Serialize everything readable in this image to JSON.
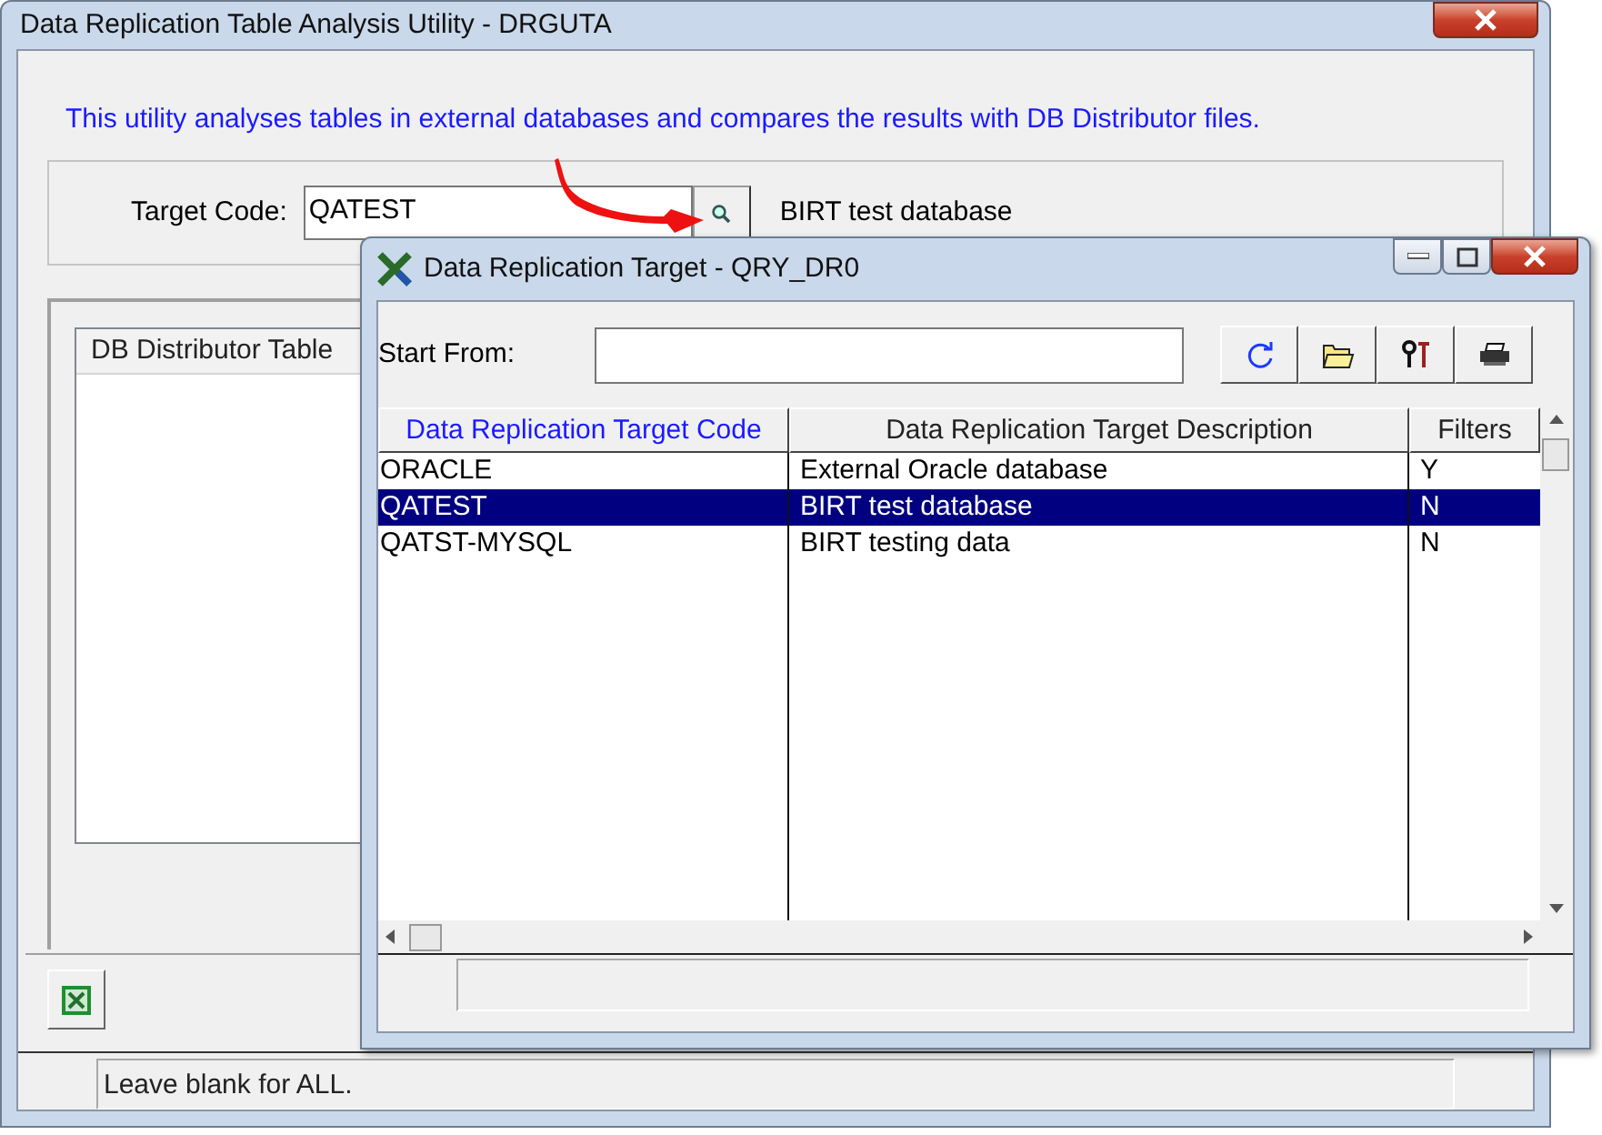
{
  "main_window": {
    "title": "Data Replication Table Analysis Utility - DRGUTA",
    "intro": "This utility analyses tables in external databases and compares the results with DB Distributor files.",
    "target_code": {
      "label": "Target Code:",
      "value": "QATEST",
      "description": "BIRT test database"
    },
    "table": {
      "columns": [
        "DB Distributor Table"
      ]
    },
    "status_bar": "Leave blank for ALL."
  },
  "dialog": {
    "title": "Data Replication Target - QRY_DR0",
    "start_from": {
      "label": "Start From:"
    },
    "columns": [
      {
        "label": "Data Replication Target Code",
        "sorted": true
      },
      {
        "label": "Data Replication Target Description",
        "sorted": false
      },
      {
        "label": "Filters",
        "sorted": false
      }
    ],
    "rows": [
      {
        "cells": [
          "ORACLE",
          "External Oracle database",
          "Y"
        ],
        "selected": false
      },
      {
        "cells": [
          "QATEST",
          "BIRT test database",
          "N"
        ],
        "selected": true
      },
      {
        "cells": [
          "QATST-MYSQL",
          "BIRT testing data",
          "N"
        ],
        "selected": false
      }
    ]
  }
}
